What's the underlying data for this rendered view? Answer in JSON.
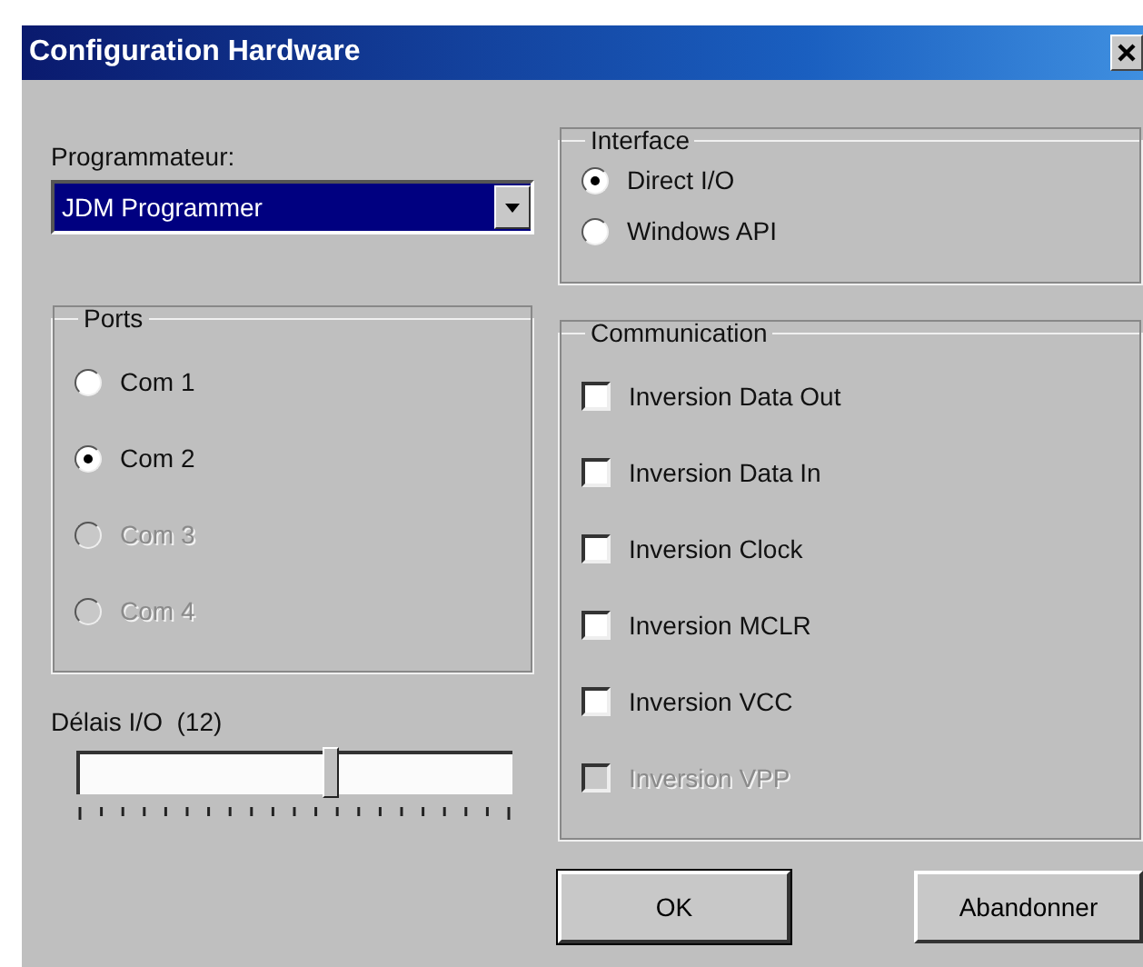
{
  "window": {
    "title": "Configuration Hardware"
  },
  "programmer": {
    "label": "Programmateur:",
    "value": "JDM Programmer"
  },
  "ports": {
    "title": "Ports",
    "options": [
      {
        "label": "Com 1",
        "selected": false,
        "disabled": false
      },
      {
        "label": "Com 2",
        "selected": true,
        "disabled": false
      },
      {
        "label": "Com 3",
        "selected": false,
        "disabled": true
      },
      {
        "label": "Com 4",
        "selected": false,
        "disabled": true
      }
    ]
  },
  "delay": {
    "label": "Délais I/O  (12)",
    "level": 0.58
  },
  "interface": {
    "title": "Interface",
    "options": [
      {
        "label": "Direct I/O",
        "selected": true,
        "disabled": false
      },
      {
        "label": "Windows API",
        "selected": false,
        "disabled": false
      }
    ]
  },
  "communication": {
    "title": "Communication",
    "options": [
      {
        "label": "Inversion Data Out",
        "checked": false,
        "disabled": false
      },
      {
        "label": "Inversion Data In",
        "checked": false,
        "disabled": false
      },
      {
        "label": "Inversion Clock",
        "checked": false,
        "disabled": false
      },
      {
        "label": "Inversion MCLR",
        "checked": false,
        "disabled": false
      },
      {
        "label": "Inversion VCC",
        "checked": false,
        "disabled": false
      },
      {
        "label": "Inversion VPP",
        "checked": false,
        "disabled": true
      }
    ]
  },
  "buttons": [
    {
      "label": "OK",
      "default": true
    },
    {
      "label": "Abandonner",
      "default": false
    }
  ]
}
